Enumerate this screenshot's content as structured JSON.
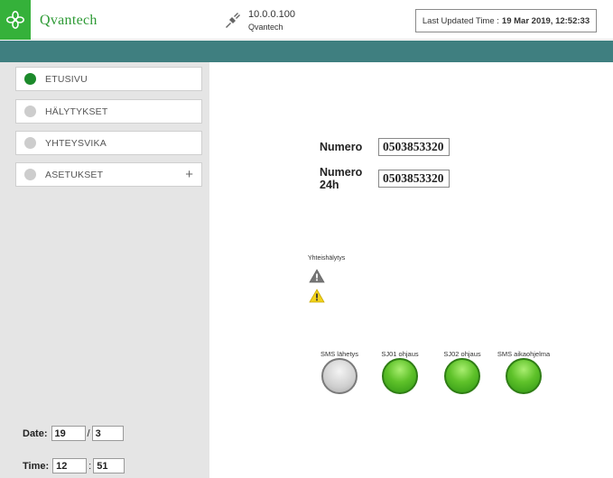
{
  "header": {
    "brand": "Qvantech",
    "ip": "10.0.0.100",
    "host": "Qvantech",
    "updated_label": "Last Updated Time :",
    "updated_value": "19 Mar 2019, 12:52:33"
  },
  "sidebar": {
    "items": [
      {
        "label": "ETUSIVU",
        "active": true
      },
      {
        "label": "HÄLYTYKSET",
        "active": false
      },
      {
        "label": "YHTEYSVIKA",
        "active": false
      },
      {
        "label": "ASETUKSET",
        "active": false,
        "expand": "+"
      }
    ],
    "date": {
      "label": "Date:",
      "day": "19",
      "sep": "/",
      "month": "3"
    },
    "time": {
      "label": "Time:",
      "hour": "12",
      "sep": ":",
      "minute": "51"
    }
  },
  "main": {
    "numero_label": "Numero",
    "numero_value": "0503853320",
    "numero24_label_line1": "Numero",
    "numero24_label_line2": "24h",
    "numero24_value": "0503853320",
    "yhteis_label": "Yhteishälytys",
    "indicators": [
      {
        "label": "SMS lähetys",
        "state": "off"
      },
      {
        "label": "SJ01 ohjaus",
        "state": "on"
      },
      {
        "label": "SJ02 ohjaus",
        "state": "on"
      },
      {
        "label": "SMS aikaohjelma",
        "state": "on"
      }
    ]
  },
  "colors": {
    "brand_green": "#35b13a",
    "teal_bar": "#3f7f80",
    "active_dot": "#1c8a2b",
    "warning_yellow": "#f2d21b",
    "warning_gray": "#777777"
  },
  "icons": {
    "logo": "flower-logo-icon",
    "connection": "plug-icon",
    "alarm_gray": "warning-gray-icon",
    "alarm_yellow": "warning-yellow-icon"
  }
}
